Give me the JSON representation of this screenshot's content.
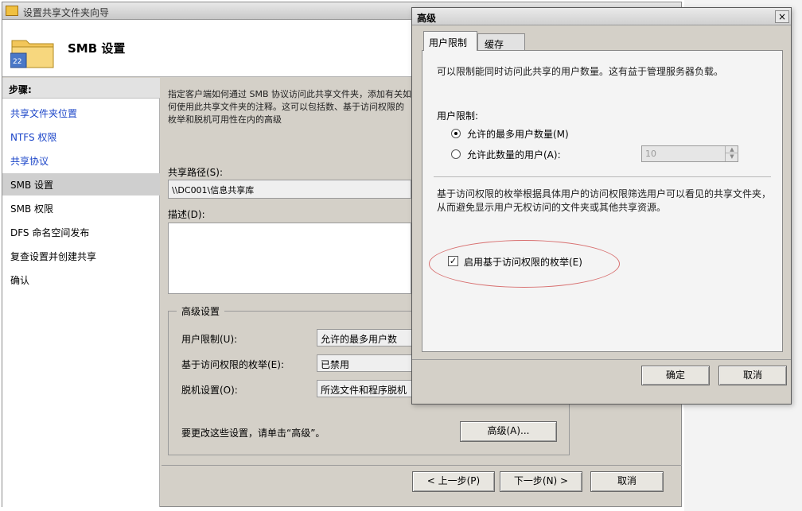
{
  "wizard": {
    "title": "设置共享文件夹向导",
    "header_title": "SMB 设置",
    "steps_title": "步骤:",
    "steps": [
      {
        "label": "共享文件夹位置"
      },
      {
        "label": "NTFS 权限"
      },
      {
        "label": "共享协议"
      },
      {
        "label": "SMB 设置"
      },
      {
        "label": "SMB 权限"
      },
      {
        "label": "DFS 命名空间发布"
      },
      {
        "label": "复查设置并创建共享"
      },
      {
        "label": "确认"
      }
    ],
    "intro_text": "指定客户端如何通过 SMB 协议访问此共享文件夹，添加有关如何使用此共享文件夹的注释。这可以包括数、基于访问权限的枚举和脱机可用性在内的高级",
    "path_label": "共享路径(S):",
    "path_value": "\\\\DC001\\信息共享库",
    "desc_label": "描述(D):",
    "desc_value": "",
    "advanced": {
      "group_title": "高级设置",
      "user_limit_label": "用户限制(U):",
      "user_limit_value": "允许的最多用户数",
      "abe_label": "基于访问权限的枚举(E):",
      "abe_value": "已禁用",
      "offline_label": "脱机设置(O):",
      "offline_value": "所选文件和程序脱机",
      "note": "要更改这些设置，请单击“高级”。",
      "button": "高级(A)..."
    },
    "back_button": "< 上一步(P)",
    "next_button": "下一步(N) >",
    "cancel_button": "取消"
  },
  "dialog": {
    "title": "高级",
    "close": "×",
    "tabs": [
      {
        "label": "用户限制"
      },
      {
        "label": "缓存"
      }
    ],
    "desc1": "可以限制能同时访问此共享的用户数量。这有益于管理服务器负载。",
    "user_limit_label": "用户限制:",
    "radio_max_label": "允许的最多用户数量(M)",
    "radio_num_label": "允许此数量的用户(A):",
    "num_value": "10",
    "spin_up": "▲",
    "spin_down": "▼",
    "desc2": "基于访问权限的枚举根据具体用户的访问权限筛选用户可以看见的共享文件夹，从而避免显示用户无权访问的文件夹或其他共享资源。",
    "abe_check_label": "启用基于访问权限的枚举(E)",
    "abe_checked": "✓",
    "ok_button": "确定",
    "cancel_button": "取消"
  },
  "colors": {
    "link": "#1a44c8",
    "highlight_ellipse": "#d87070",
    "window_bg": "#d4d0c8"
  }
}
